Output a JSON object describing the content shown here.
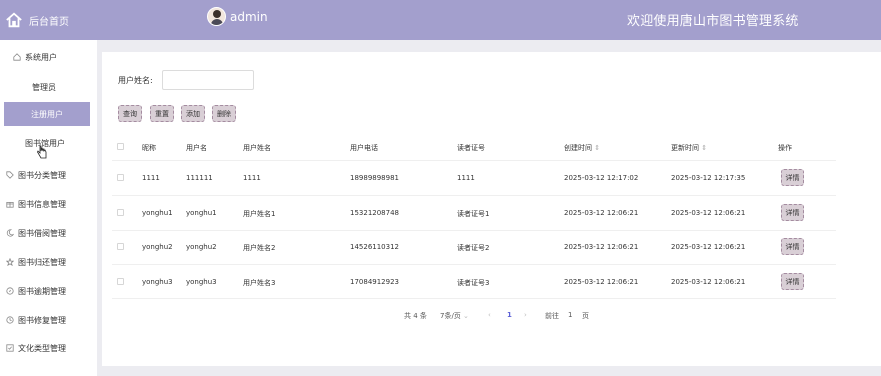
{
  "header": {
    "brand_label": "后台首页",
    "username": "admin",
    "site_title": "欢迎使用唐山市图书管理系统"
  },
  "sidebar": {
    "items": [
      {
        "label": "系统用户",
        "icon": "home-outline-icon"
      },
      {
        "label": "管理员",
        "icon": ""
      },
      {
        "label": "注册用户",
        "icon": ""
      },
      {
        "label": "图书馆用户",
        "icon": ""
      },
      {
        "label": "图书分类管理",
        "icon": "tag-icon"
      },
      {
        "label": "图书信息管理",
        "icon": "gift-icon"
      },
      {
        "label": "图书借阅管理",
        "icon": "moon-icon"
      },
      {
        "label": "图书归还管理",
        "icon": "star-icon"
      },
      {
        "label": "图书逾期管理",
        "icon": "compass-icon"
      },
      {
        "label": "图书修复管理",
        "icon": "clock-icon"
      },
      {
        "label": "文化类型管理",
        "icon": "checkbox-icon"
      }
    ]
  },
  "search": {
    "label": "用户姓名:",
    "value": "",
    "placeholder": ""
  },
  "toolbar": {
    "query": "查询",
    "reset": "重置",
    "add": "添加",
    "delete": "删除"
  },
  "table": {
    "headers": [
      "昵称",
      "用户名",
      "用户姓名",
      "用户电话",
      "读者证号",
      "创建时间",
      "更新时间",
      "操作"
    ],
    "sort_icon": "⇕",
    "detail_label": "详情",
    "rows": [
      [
        "1111",
        "111111",
        "1111",
        "18989898981",
        "1111",
        "2025-03-12 12:17:02",
        "2025-03-12 12:17:35"
      ],
      [
        "yonghu1",
        "yonghu1",
        "用户姓名1",
        "15321208748",
        "读者证号1",
        "2025-03-12 12:06:21",
        "2025-03-12 12:06:21"
      ],
      [
        "yonghu2",
        "yonghu2",
        "用户姓名2",
        "14526110312",
        "读者证号2",
        "2025-03-12 12:06:21",
        "2025-03-12 12:06:21"
      ],
      [
        "yonghu3",
        "yonghu3",
        "用户姓名3",
        "17084912923",
        "读者证号3",
        "2025-03-12 12:06:21",
        "2025-03-12 12:06:21"
      ]
    ]
  },
  "pagination": {
    "total": "共 4 条",
    "page_size": "7条/页",
    "page_size_arrow": "⌄",
    "prev": "‹",
    "current": "1",
    "next": "›",
    "goto_label": "前往",
    "goto_value": "1",
    "page_unit": "页"
  },
  "colors": {
    "accent": "#a39fcd",
    "button_bg": "#d9cfd6",
    "active_page": "#5b5fd6"
  }
}
